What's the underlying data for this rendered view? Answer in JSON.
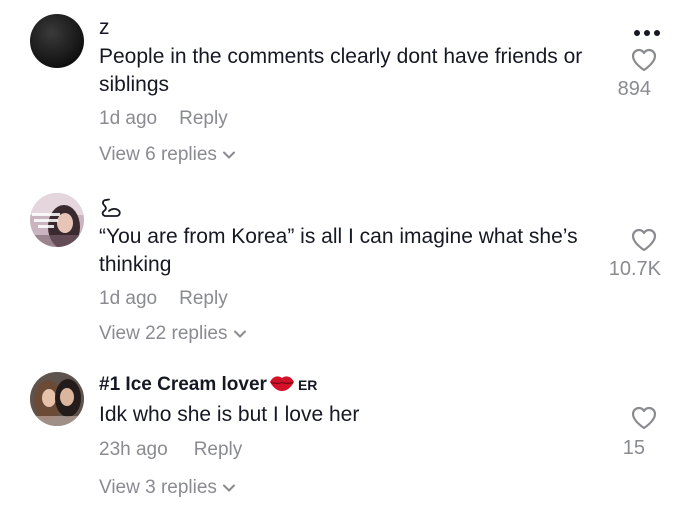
{
  "comments": [
    {
      "username": "z",
      "text": "People in the comments clearly dont have friends or siblings",
      "time": "1d ago",
      "reply_label": "Reply",
      "view_replies": "View 6 replies",
      "likes": "894",
      "avatar_icon": "black-circle-avatar"
    },
    {
      "username": "",
      "username_icon": "swan-icon",
      "text": "“You are from Korea” is all I can imagine what she’s thinking",
      "time": "1d ago",
      "reply_label": "Reply",
      "view_replies": "View 22 replies",
      "likes": "10.7K",
      "avatar_icon": "photo-avatar"
    },
    {
      "username": "#1 Ice Cream lover",
      "username_suffix": "ER",
      "username_icon": "lips-icon",
      "text": "Idk who she is but I love her",
      "time": "23h ago",
      "reply_label": "Reply",
      "view_replies": "View 3 replies",
      "likes": "15",
      "avatar_icon": "photo-avatar"
    }
  ],
  "colors": {
    "text": "#161823",
    "muted": "#8a8b91",
    "lips": "#d3122a"
  }
}
